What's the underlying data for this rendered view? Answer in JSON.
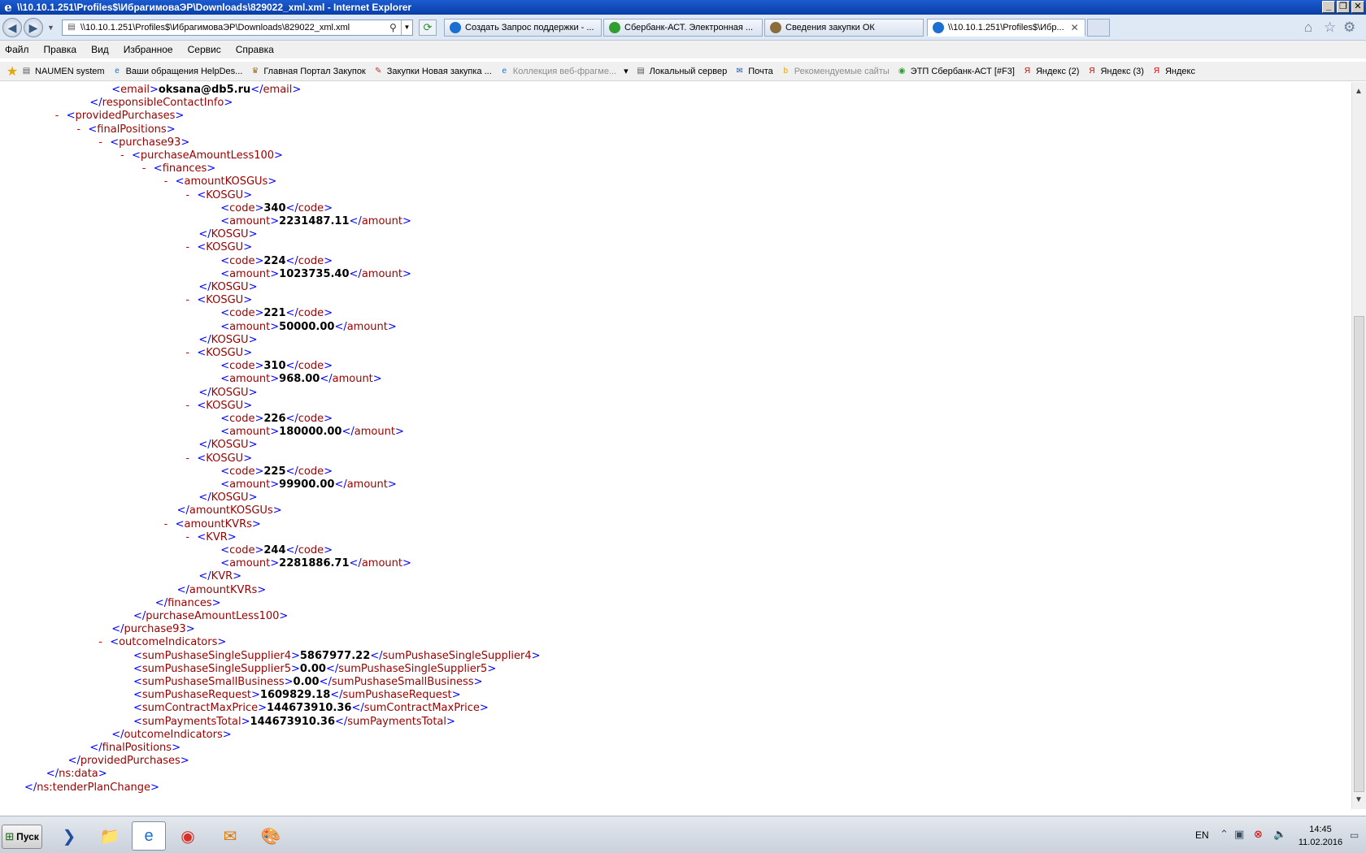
{
  "window": {
    "title": "\\\\10.10.1.251\\Profiles$\\ИбрагимоваЭР\\Downloads\\829022_xml.xml - Internet Explorer",
    "minimize_label": "_",
    "maximize_label": "❐",
    "close_label": "✕"
  },
  "address": {
    "url": "\\\\10.10.1.251\\Profiles$\\ИбрагимоваЭР\\Downloads\\829022_xml.xml"
  },
  "tabs": [
    {
      "label": "Создать Запрос поддержки - ...",
      "icon_color": "#1a6fd1",
      "active": false
    },
    {
      "label": "Сбербанк-АСТ. Электронная ...",
      "icon_color": "#2f9e2f",
      "active": false
    },
    {
      "label": "Сведения закупки ОК",
      "icon_color": "#8a6d3b",
      "active": false
    },
    {
      "label": "\\\\10.10.1.251\\Profiles$\\Ибр...",
      "icon_color": "#1a6fd1",
      "active": true
    }
  ],
  "menu": [
    "Файл",
    "Правка",
    "Вид",
    "Избранное",
    "Сервис",
    "Справка"
  ],
  "favorites": [
    {
      "label": "NAUMEN system",
      "icon": "page-icon",
      "grey": false
    },
    {
      "label": "Ваши обращения  HelpDes...",
      "icon": "ie-icon",
      "grey": false
    },
    {
      "label": "Главная Портал Закупок",
      "icon": "emblem-icon",
      "grey": false
    },
    {
      "label": "Закупки  Новая закупка  ...",
      "icon": "tools-icon",
      "grey": false
    },
    {
      "label": "Коллекция веб-фрагме...",
      "icon": "ie-icon",
      "grey": true
    },
    {
      "label": "Локальный сервер",
      "icon": "page-icon",
      "grey": false
    },
    {
      "label": "Почта",
      "icon": "mail-icon",
      "grey": false
    },
    {
      "label": "Рекомендуемые сайты",
      "icon": "bing-icon",
      "grey": true
    },
    {
      "label": "ЭТП Сбербанк-АСТ [#F3]",
      "icon": "sber-icon",
      "grey": false
    },
    {
      "label": "Яндекс (2)",
      "icon": "yandex-icon",
      "grey": false
    },
    {
      "label": "Яндекс (3)",
      "icon": "yandex-icon",
      "grey": false
    },
    {
      "label": "Яндекс",
      "icon": "yandex-icon",
      "grey": false
    }
  ],
  "xml_lines": [
    {
      "indent": 4,
      "minus": false,
      "kind": "leaf",
      "name": "email",
      "value": "oksana@db5.ru"
    },
    {
      "indent": 3,
      "minus": false,
      "kind": "close",
      "name": "responsibleContactInfo"
    },
    {
      "indent": 2,
      "minus": true,
      "kind": "open",
      "name": "providedPurchases"
    },
    {
      "indent": 3,
      "minus": true,
      "kind": "open",
      "name": "finalPositions"
    },
    {
      "indent": 4,
      "minus": true,
      "kind": "open",
      "name": "purchase93"
    },
    {
      "indent": 5,
      "minus": true,
      "kind": "open",
      "name": "purchaseAmountLess100"
    },
    {
      "indent": 6,
      "minus": true,
      "kind": "open",
      "name": "finances"
    },
    {
      "indent": 7,
      "minus": true,
      "kind": "open",
      "name": "amountKOSGUs"
    },
    {
      "indent": 8,
      "minus": true,
      "kind": "open",
      "name": "KOSGU"
    },
    {
      "indent": 9,
      "minus": false,
      "kind": "leaf",
      "name": "code",
      "value": "340"
    },
    {
      "indent": 9,
      "minus": false,
      "kind": "leaf",
      "name": "amount",
      "value": "2231487.11"
    },
    {
      "indent": 8,
      "minus": false,
      "kind": "close",
      "name": "KOSGU"
    },
    {
      "indent": 8,
      "minus": true,
      "kind": "open",
      "name": "KOSGU"
    },
    {
      "indent": 9,
      "minus": false,
      "kind": "leaf",
      "name": "code",
      "value": "224"
    },
    {
      "indent": 9,
      "minus": false,
      "kind": "leaf",
      "name": "amount",
      "value": "1023735.40"
    },
    {
      "indent": 8,
      "minus": false,
      "kind": "close",
      "name": "KOSGU"
    },
    {
      "indent": 8,
      "minus": true,
      "kind": "open",
      "name": "KOSGU"
    },
    {
      "indent": 9,
      "minus": false,
      "kind": "leaf",
      "name": "code",
      "value": "221"
    },
    {
      "indent": 9,
      "minus": false,
      "kind": "leaf",
      "name": "amount",
      "value": "50000.00"
    },
    {
      "indent": 8,
      "minus": false,
      "kind": "close",
      "name": "KOSGU"
    },
    {
      "indent": 8,
      "minus": true,
      "kind": "open",
      "name": "KOSGU"
    },
    {
      "indent": 9,
      "minus": false,
      "kind": "leaf",
      "name": "code",
      "value": "310"
    },
    {
      "indent": 9,
      "minus": false,
      "kind": "leaf",
      "name": "amount",
      "value": "968.00"
    },
    {
      "indent": 8,
      "minus": false,
      "kind": "close",
      "name": "KOSGU"
    },
    {
      "indent": 8,
      "minus": true,
      "kind": "open",
      "name": "KOSGU"
    },
    {
      "indent": 9,
      "minus": false,
      "kind": "leaf",
      "name": "code",
      "value": "226"
    },
    {
      "indent": 9,
      "minus": false,
      "kind": "leaf",
      "name": "amount",
      "value": "180000.00"
    },
    {
      "indent": 8,
      "minus": false,
      "kind": "close",
      "name": "KOSGU"
    },
    {
      "indent": 8,
      "minus": true,
      "kind": "open",
      "name": "KOSGU"
    },
    {
      "indent": 9,
      "minus": false,
      "kind": "leaf",
      "name": "code",
      "value": "225"
    },
    {
      "indent": 9,
      "minus": false,
      "kind": "leaf",
      "name": "amount",
      "value": "99900.00"
    },
    {
      "indent": 8,
      "minus": false,
      "kind": "close",
      "name": "KOSGU"
    },
    {
      "indent": 7,
      "minus": false,
      "kind": "close",
      "name": "amountKOSGUs"
    },
    {
      "indent": 7,
      "minus": true,
      "kind": "open",
      "name": "amountKVRs"
    },
    {
      "indent": 8,
      "minus": true,
      "kind": "open",
      "name": "KVR"
    },
    {
      "indent": 9,
      "minus": false,
      "kind": "leaf",
      "name": "code",
      "value": "244"
    },
    {
      "indent": 9,
      "minus": false,
      "kind": "leaf",
      "name": "amount",
      "value": "2281886.71"
    },
    {
      "indent": 8,
      "minus": false,
      "kind": "close",
      "name": "KVR"
    },
    {
      "indent": 7,
      "minus": false,
      "kind": "close",
      "name": "amountKVRs"
    },
    {
      "indent": 6,
      "minus": false,
      "kind": "close",
      "name": "finances"
    },
    {
      "indent": 5,
      "minus": false,
      "kind": "close",
      "name": "purchaseAmountLess100"
    },
    {
      "indent": 4,
      "minus": false,
      "kind": "close",
      "name": "purchase93"
    },
    {
      "indent": 4,
      "minus": true,
      "kind": "open",
      "name": "outcomeIndicators"
    },
    {
      "indent": 5,
      "minus": false,
      "kind": "leaf",
      "name": "sumPushaseSingleSupplier4",
      "value": "5867977.22"
    },
    {
      "indent": 5,
      "minus": false,
      "kind": "leaf",
      "name": "sumPushaseSingleSupplier5",
      "value": "0.00"
    },
    {
      "indent": 5,
      "minus": false,
      "kind": "leaf",
      "name": "sumPushaseSmallBusiness",
      "value": "0.00"
    },
    {
      "indent": 5,
      "minus": false,
      "kind": "leaf",
      "name": "sumPushaseRequest",
      "value": "1609829.18"
    },
    {
      "indent": 5,
      "minus": false,
      "kind": "leaf",
      "name": "sumContractMaxPrice",
      "value": "144673910.36"
    },
    {
      "indent": 5,
      "minus": false,
      "kind": "leaf",
      "name": "sumPaymentsTotal",
      "value": "144673910.36"
    },
    {
      "indent": 4,
      "minus": false,
      "kind": "close",
      "name": "outcomeIndicators"
    },
    {
      "indent": 3,
      "minus": false,
      "kind": "close",
      "name": "finalPositions"
    },
    {
      "indent": 2,
      "minus": false,
      "kind": "close",
      "name": "providedPurchases"
    },
    {
      "indent": 1,
      "minus": false,
      "kind": "close",
      "name": "ns:data"
    },
    {
      "indent": 0,
      "minus": false,
      "kind": "close",
      "name": "ns:tenderPlanChange"
    }
  ],
  "taskbar": {
    "start_label": "Пуск",
    "apps": [
      {
        "icon": "powershell-icon",
        "glyph": "❯",
        "active": false
      },
      {
        "icon": "explorer-icon",
        "glyph": "📁",
        "active": false
      },
      {
        "icon": "ie-icon",
        "glyph": "e",
        "active": true
      },
      {
        "icon": "chrome-icon",
        "glyph": "◉",
        "active": false
      },
      {
        "icon": "outlook-icon",
        "glyph": "✉",
        "active": false
      },
      {
        "icon": "paint-icon",
        "glyph": "🎨",
        "active": false
      }
    ],
    "lang": "EN",
    "time": "14:45",
    "date": "11.02.2016"
  }
}
